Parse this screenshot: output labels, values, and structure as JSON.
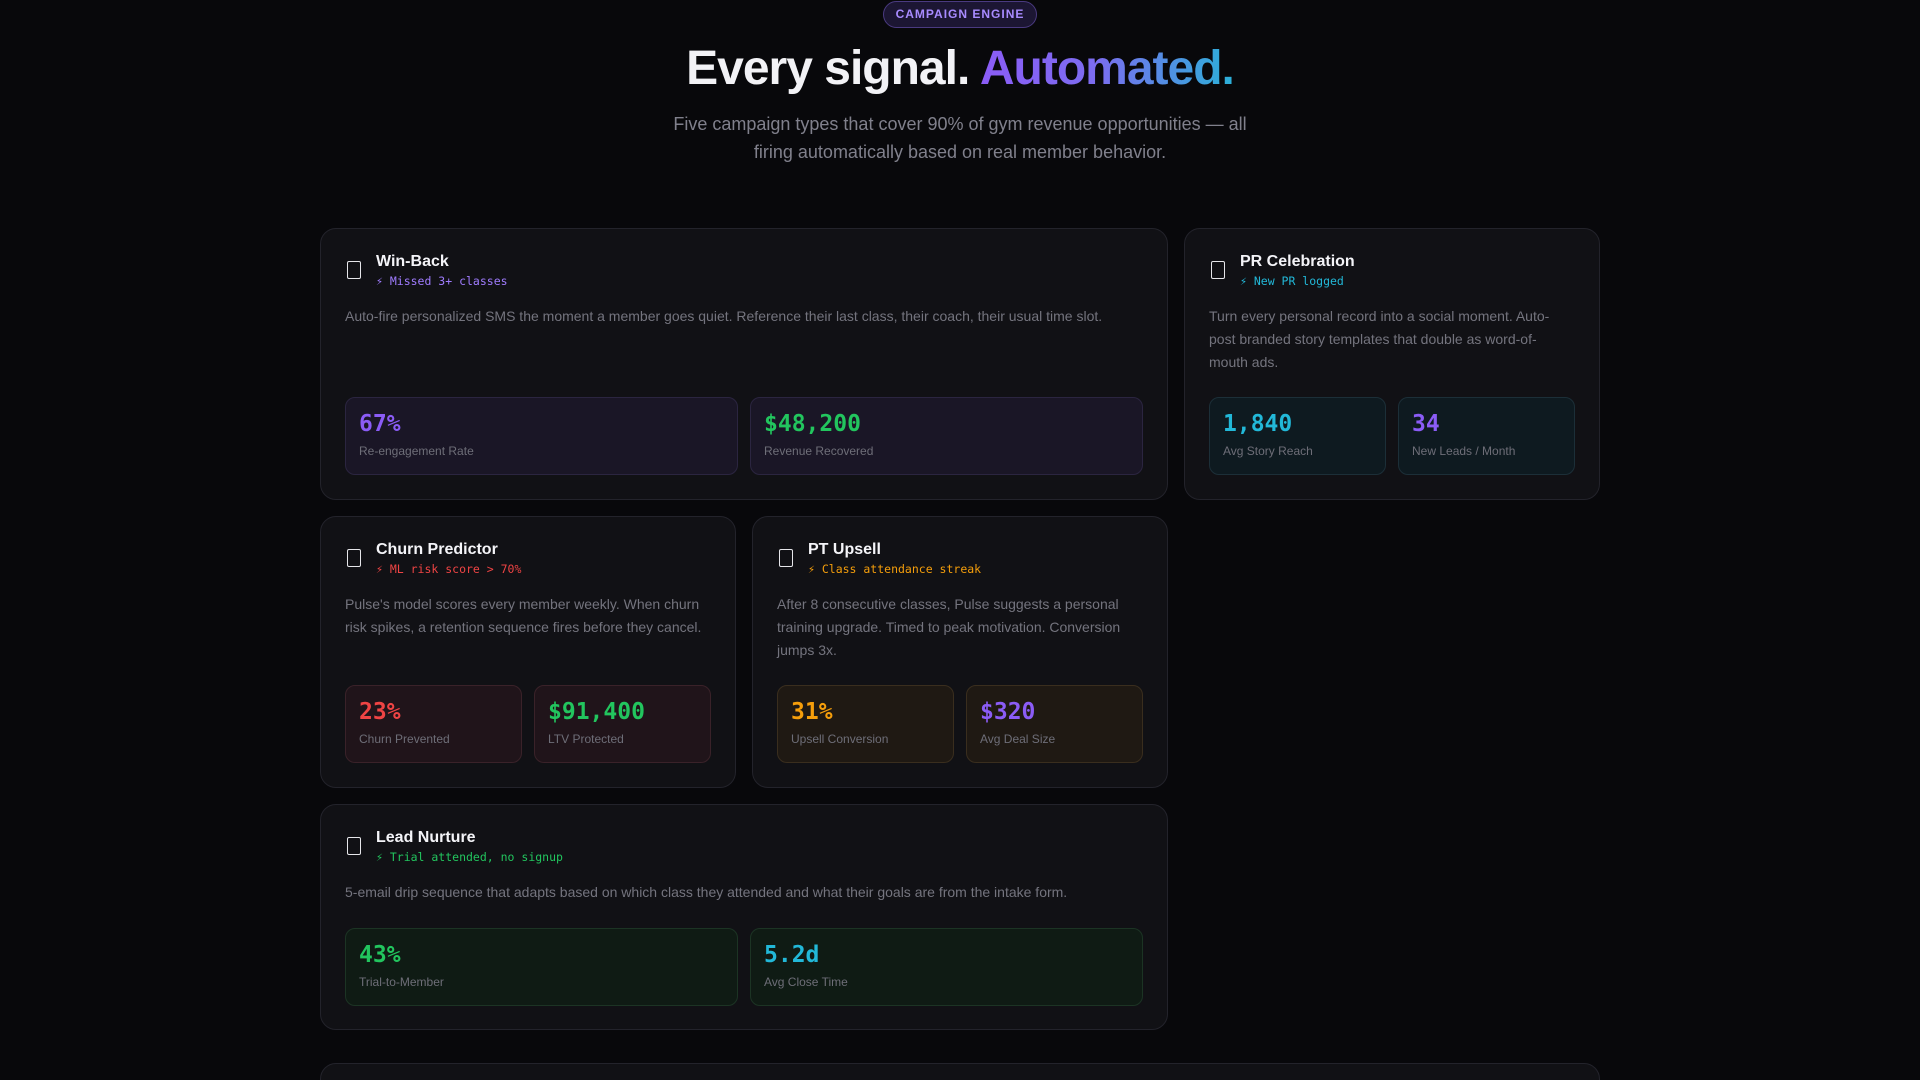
{
  "hero": {
    "badge": "CAMPAIGN ENGINE",
    "title_plain": "Every signal.",
    "title_accent": "Automated.",
    "subtitle": "Five campaign types that cover 90% of gym revenue opportunities — all firing automatically based on real member behavior."
  },
  "colors": {
    "purple": "#8b5cf6",
    "green": "#22c55e",
    "cyan": "#22b8d8",
    "red": "#ef4444",
    "amber": "#f59e0b"
  },
  "cards": {
    "winback": {
      "icon": "rectangle-icon",
      "title": "Win-Back",
      "trigger": "⚡ Missed 3+ classes",
      "description": "Auto-fire personalized SMS the moment a member goes quiet. Reference their last class, their coach, their usual time slot.",
      "stats": [
        {
          "value": "67%",
          "label": "Re-engagement Rate"
        },
        {
          "value": "$48,200",
          "label": "Revenue Recovered"
        }
      ]
    },
    "pr": {
      "icon": "rectangle-icon",
      "title": "PR Celebration",
      "trigger": "⚡ New PR logged",
      "description": "Turn every personal record into a social moment. Auto-post branded story templates that double as word-of-mouth ads.",
      "stats": [
        {
          "value": "1,840",
          "label": "Avg Story Reach"
        },
        {
          "value": "34",
          "label": "New Leads / Month"
        }
      ]
    },
    "churn": {
      "icon": "rectangle-icon",
      "title": "Churn Predictor",
      "trigger": "⚡ ML risk score > 70%",
      "description": "Pulse's model scores every member weekly. When churn risk spikes, a retention sequence fires before they cancel.",
      "stats": [
        {
          "value": "23%",
          "label": "Churn Prevented"
        },
        {
          "value": "$91,400",
          "label": "LTV Protected"
        }
      ]
    },
    "pt": {
      "icon": "rectangle-icon",
      "title": "PT Upsell",
      "trigger": "⚡ Class attendance streak",
      "description": "After 8 consecutive classes, Pulse suggests a personal training upgrade. Timed to peak motivation. Conversion jumps 3x.",
      "stats": [
        {
          "value": "31%",
          "label": "Upsell Conversion"
        },
        {
          "value": "$320",
          "label": "Avg Deal Size"
        }
      ]
    },
    "lead": {
      "icon": "rectangle-icon",
      "title": "Lead Nurture",
      "trigger": "⚡ Trial attended, no signup",
      "description": "5-email drip sequence that adapts based on which class they attended and what their goals are from the intake form.",
      "stats": [
        {
          "value": "43%",
          "label": "Trial-to-Member"
        },
        {
          "value": "5.2d",
          "label": "Avg Close Time"
        }
      ]
    }
  }
}
